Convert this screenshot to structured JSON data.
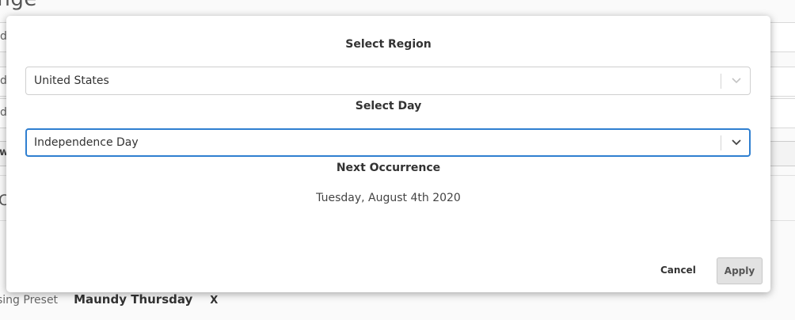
{
  "background": {
    "title_fragment": "ange",
    "field_fragments": [
      "d",
      "d",
      "d"
    ],
    "button_fragment": "w",
    "section_fragment": "C",
    "preset_label": "sing Preset",
    "preset_value": "Maundy Thursday",
    "preset_remove": "X"
  },
  "modal": {
    "region": {
      "title": "Select Region",
      "selected": "United States"
    },
    "day": {
      "title": "Select Day",
      "selected": "Independence Day"
    },
    "occurrence": {
      "title": "Next Occurrence",
      "date": "Tuesday, August 4th 2020"
    },
    "cancel_label": "Cancel",
    "apply_label": "Apply"
  },
  "colors": {
    "focus_border": "#2f7fd0",
    "apply_bg": "#e2e2e2"
  },
  "icons": {
    "dropdown": "chevron-down-icon"
  }
}
